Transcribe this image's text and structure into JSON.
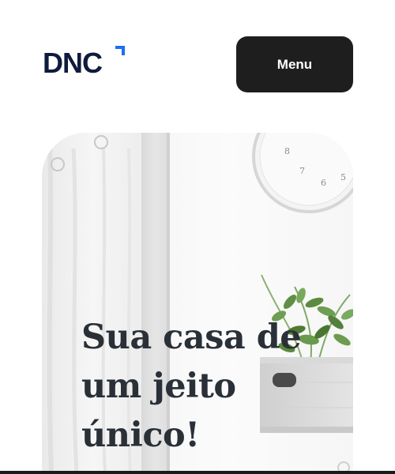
{
  "header": {
    "logo_text": "DNC",
    "menu_label": "Menu"
  },
  "hero": {
    "title_line1": "Sua casa de",
    "title_line2": "um jeito",
    "title_line3": "único!"
  },
  "clock": {
    "numerals": [
      "8",
      "7",
      "6",
      "5"
    ]
  },
  "colors": {
    "brand_navy": "#0f1b3d",
    "brand_accent": "#1d6ff2",
    "menu_bg": "#1e1e1e",
    "title_text": "#2a3038"
  }
}
